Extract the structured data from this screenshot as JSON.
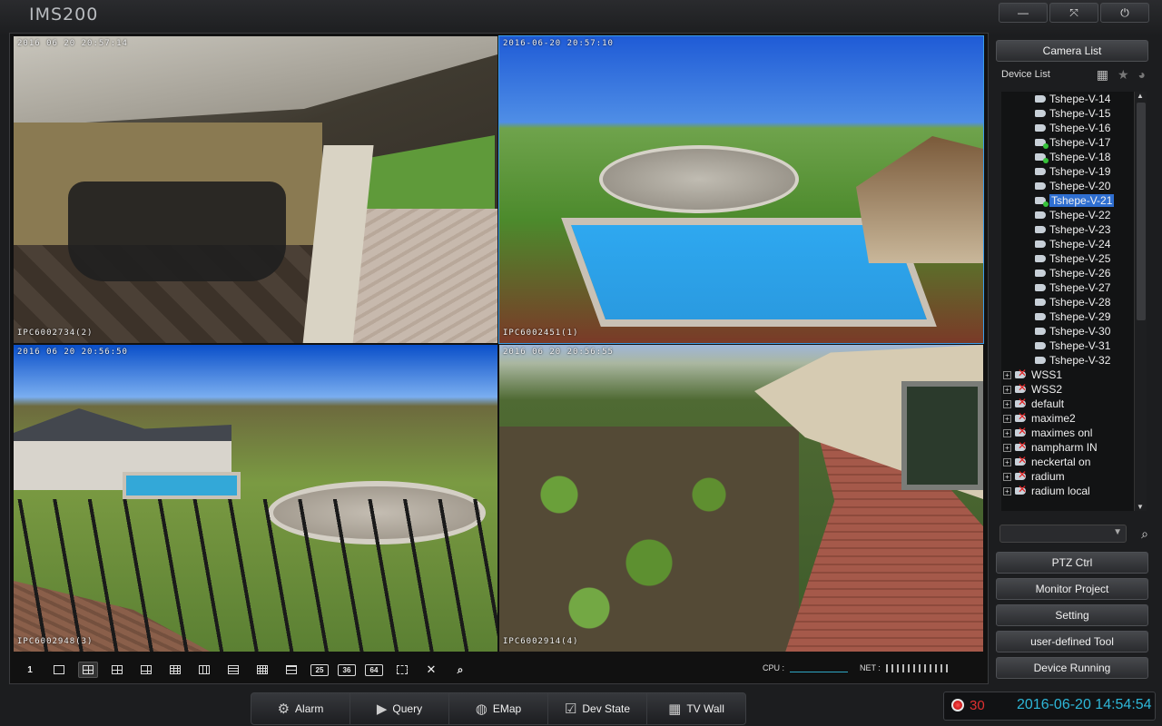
{
  "app": {
    "title": "IMS200"
  },
  "window_buttons": [
    {
      "name": "minimize",
      "glyph": "—"
    },
    {
      "name": "maximize",
      "glyph": "⤧"
    },
    {
      "name": "power",
      "glyph": "⏻"
    }
  ],
  "cameras": [
    {
      "timestamp": "2016 06 20 20:57:14",
      "name": "IPC6002734(2)"
    },
    {
      "timestamp": "2016-06-20 20:57:10",
      "name": "IPC6002451(1)"
    },
    {
      "timestamp": "2016 06 20 20:56:50",
      "name": "IPC6002948(3)"
    },
    {
      "timestamp": "2016 06 20 20:56:55",
      "name": "IPC6002914(4)"
    }
  ],
  "layout_toolbar": {
    "single_label": "1",
    "num_labels": [
      "25",
      "36",
      "64"
    ],
    "cpu_label": "CPU :",
    "net_label": "NET :"
  },
  "panel": {
    "camera_list_label": "Camera List",
    "device_list_label": "Device List",
    "cameras": [
      {
        "label": "Tshepe-V-14",
        "online": false
      },
      {
        "label": "Tshepe-V-15",
        "online": false
      },
      {
        "label": "Tshepe-V-16",
        "online": false
      },
      {
        "label": "Tshepe-V-17",
        "online": true
      },
      {
        "label": "Tshepe-V-18",
        "online": true
      },
      {
        "label": "Tshepe-V-19",
        "online": false
      },
      {
        "label": "Tshepe-V-20",
        "online": false
      },
      {
        "label": "Tshepe-V-21",
        "online": true,
        "selected": true
      },
      {
        "label": "Tshepe-V-22",
        "online": false
      },
      {
        "label": "Tshepe-V-23",
        "online": false
      },
      {
        "label": "Tshepe-V-24",
        "online": false
      },
      {
        "label": "Tshepe-V-25",
        "online": false
      },
      {
        "label": "Tshepe-V-26",
        "online": false
      },
      {
        "label": "Tshepe-V-27",
        "online": false
      },
      {
        "label": "Tshepe-V-28",
        "online": false
      },
      {
        "label": "Tshepe-V-29",
        "online": false
      },
      {
        "label": "Tshepe-V-30",
        "online": false
      },
      {
        "label": "Tshepe-V-31",
        "online": false
      },
      {
        "label": "Tshepe-V-32",
        "online": false
      }
    ],
    "groups": [
      "WSS1",
      "WSS2",
      "default",
      "maxime2",
      "maximes onl",
      "nampharm IN",
      "neckertal on",
      "radium",
      "radium local"
    ],
    "buttons": [
      "PTZ Ctrl",
      "Monitor Project",
      "Setting",
      "user-defined Tool",
      "Device Running"
    ]
  },
  "bottom_nav": [
    {
      "label": "Alarm",
      "icon": "alarm-icon",
      "glyph": "⚙"
    },
    {
      "label": "Query",
      "icon": "camera-icon",
      "glyph": "▶"
    },
    {
      "label": "EMap",
      "icon": "globe-icon",
      "glyph": "◍"
    },
    {
      "label": "Dev State",
      "icon": "device-state-icon",
      "glyph": "☑"
    },
    {
      "label": "TV Wall",
      "icon": "grid-icon",
      "glyph": "▦"
    }
  ],
  "status": {
    "alarm_count": "30",
    "datetime": "2016-06-20 14:54:54"
  },
  "colors": {
    "accent": "#2eb7d8",
    "selection": "#2f6fd1",
    "alarm": "#e03030"
  }
}
